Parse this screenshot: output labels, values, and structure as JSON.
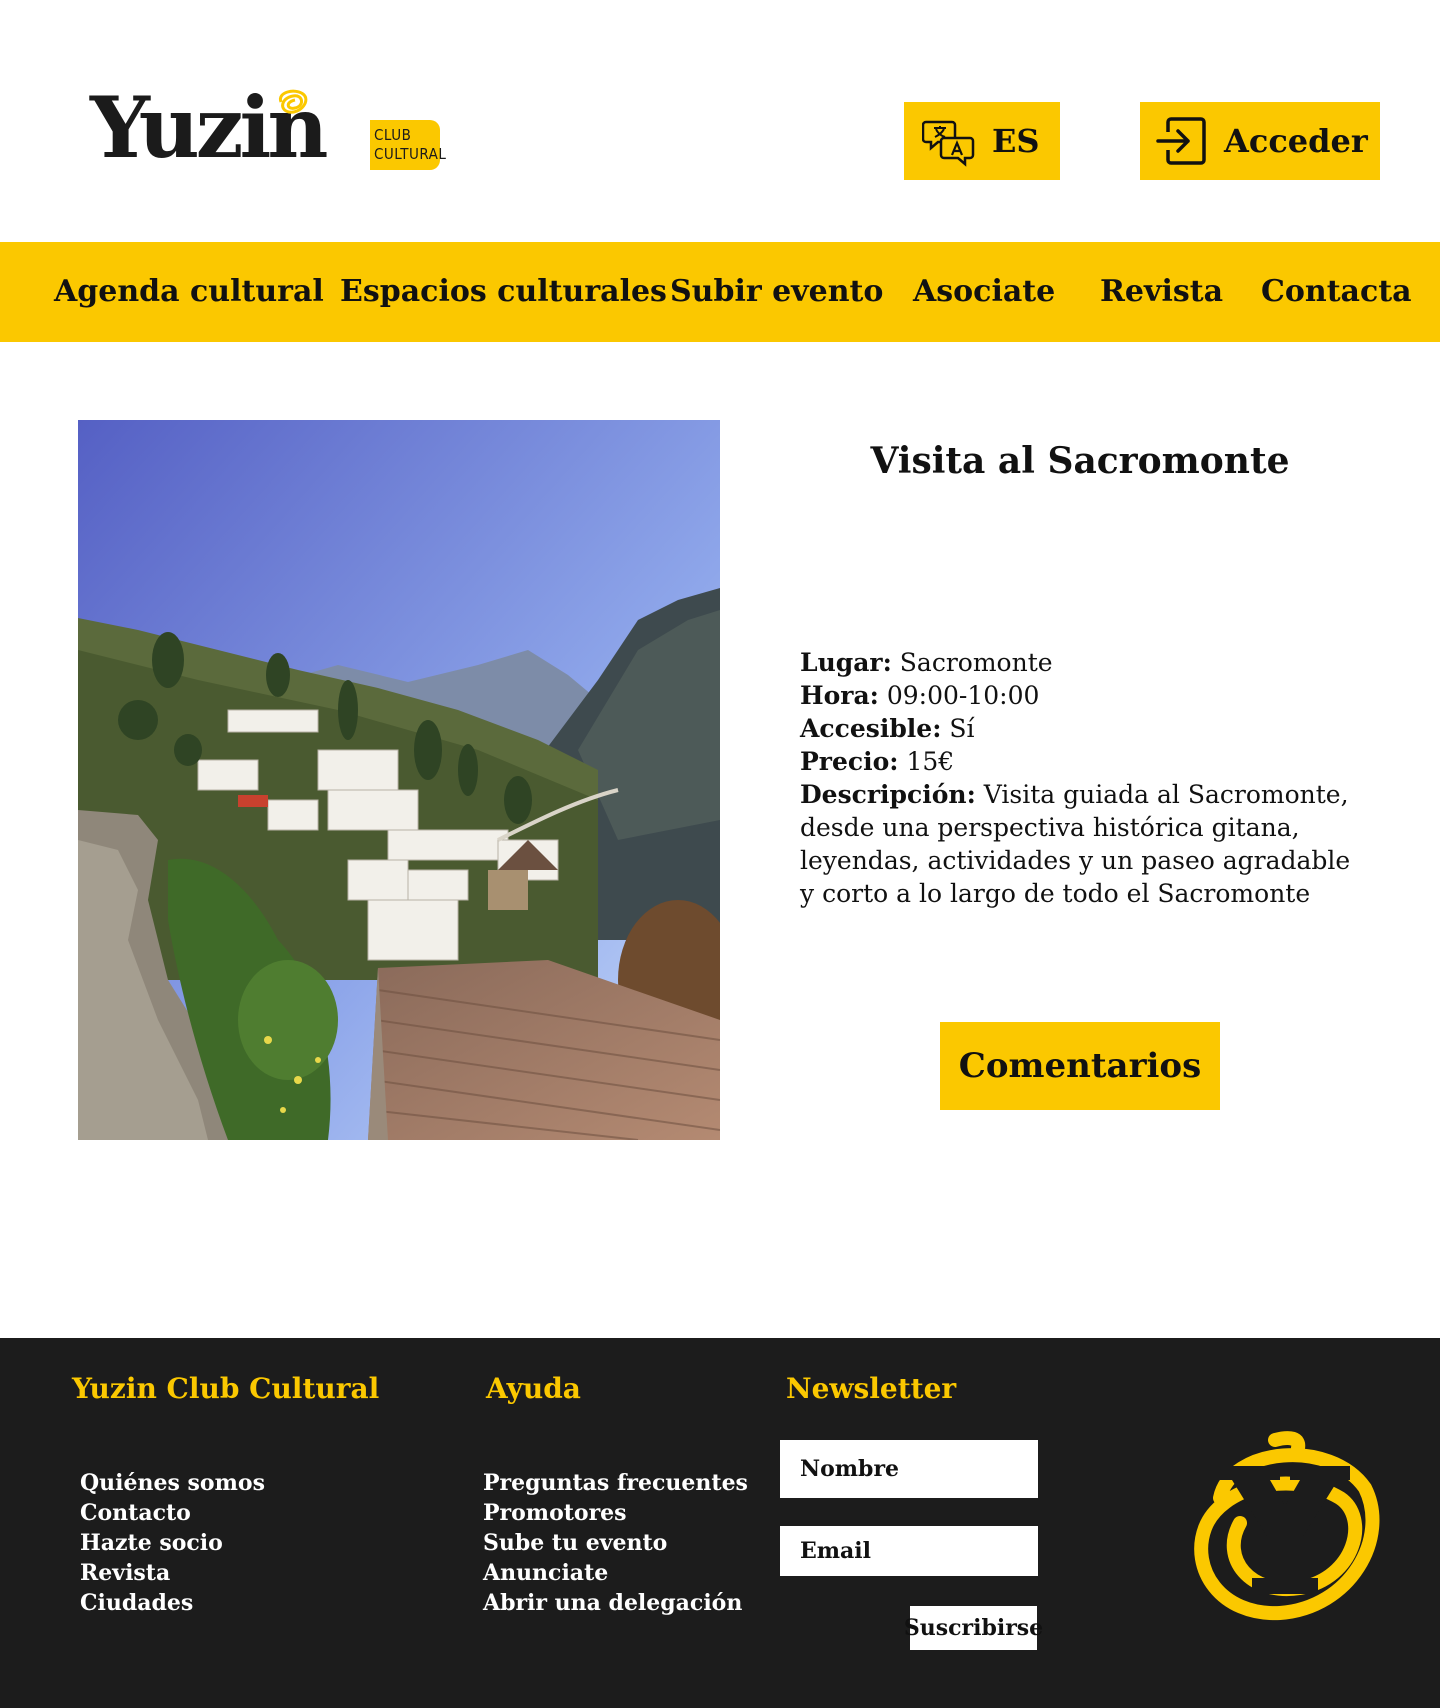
{
  "header": {
    "logo_text": "Yuzin",
    "logo_tag_line1": "CLUB",
    "logo_tag_line2": "CULTURAL",
    "language_icon": "translate-icon",
    "language_label": "ES",
    "login_icon": "login-icon",
    "login_label": "Acceder"
  },
  "nav": {
    "items": [
      {
        "label": "Agenda cultural"
      },
      {
        "label": "Espacios culturales"
      },
      {
        "label": "Subir evento"
      },
      {
        "label": "Asociate"
      },
      {
        "label": "Revista"
      },
      {
        "label": "Contacta"
      }
    ]
  },
  "event": {
    "title": "Visita al Sacromonte",
    "place_label": "Lugar:",
    "place_value": "Sacromonte",
    "time_label": "Hora:",
    "time_value": "09:00-10:00",
    "accessible_label": "Accesible:",
    "accessible_value": "Sí",
    "price_label": "Precio:",
    "price_value": "15€",
    "description_label": "Descripción:",
    "description_value": "Visita guiada al Sacromonte, desde una perspectiva histórica gitana, leyendas, actividades y un paseo agradable y corto a lo largo de todo el Sacromonte",
    "comments_label": "Comentarios"
  },
  "footer": {
    "col1_title": "Yuzin Club Cultural",
    "col1_links": [
      "Quiénes somos",
      "Contacto",
      "Hazte socio",
      "Revista",
      "Ciudades"
    ],
    "col2_title": "Ayuda",
    "col2_links": [
      "Preguntas frecuentes",
      "Promotores",
      "Sube tu evento",
      "Anunciate",
      "Abrir una delegación"
    ],
    "newsletter_title": "Newsletter",
    "name_placeholder": "Nombre",
    "email_placeholder": "Email",
    "subscribe_label": "Suscribirse"
  },
  "colors": {
    "accent": "#fbc800",
    "footer_bg": "#1c1c1c",
    "text": "#111111"
  }
}
